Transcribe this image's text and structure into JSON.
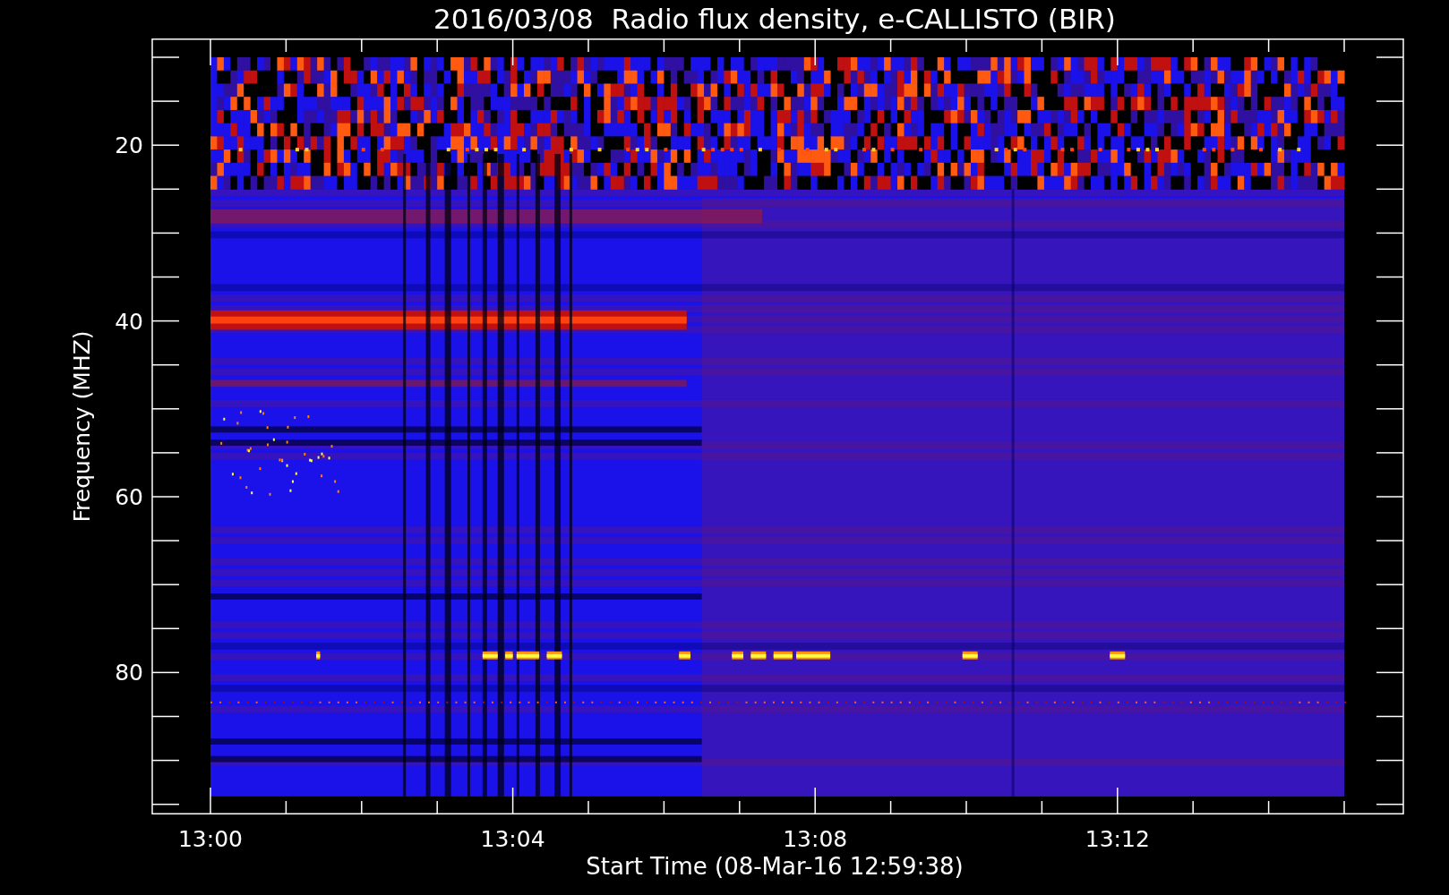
{
  "plot": {
    "title": "2016/03/08  Radio flux density, e-CALLISTO (BIR)",
    "ylabel": "Frequency (MHZ)",
    "xlabel": "Start Time (08-Mar-16 12:59:38)",
    "yticks": [
      "20",
      "40",
      "60",
      "80"
    ],
    "xticks": [
      "13:00",
      "13:04",
      "13:08",
      "13:12"
    ]
  }
}
